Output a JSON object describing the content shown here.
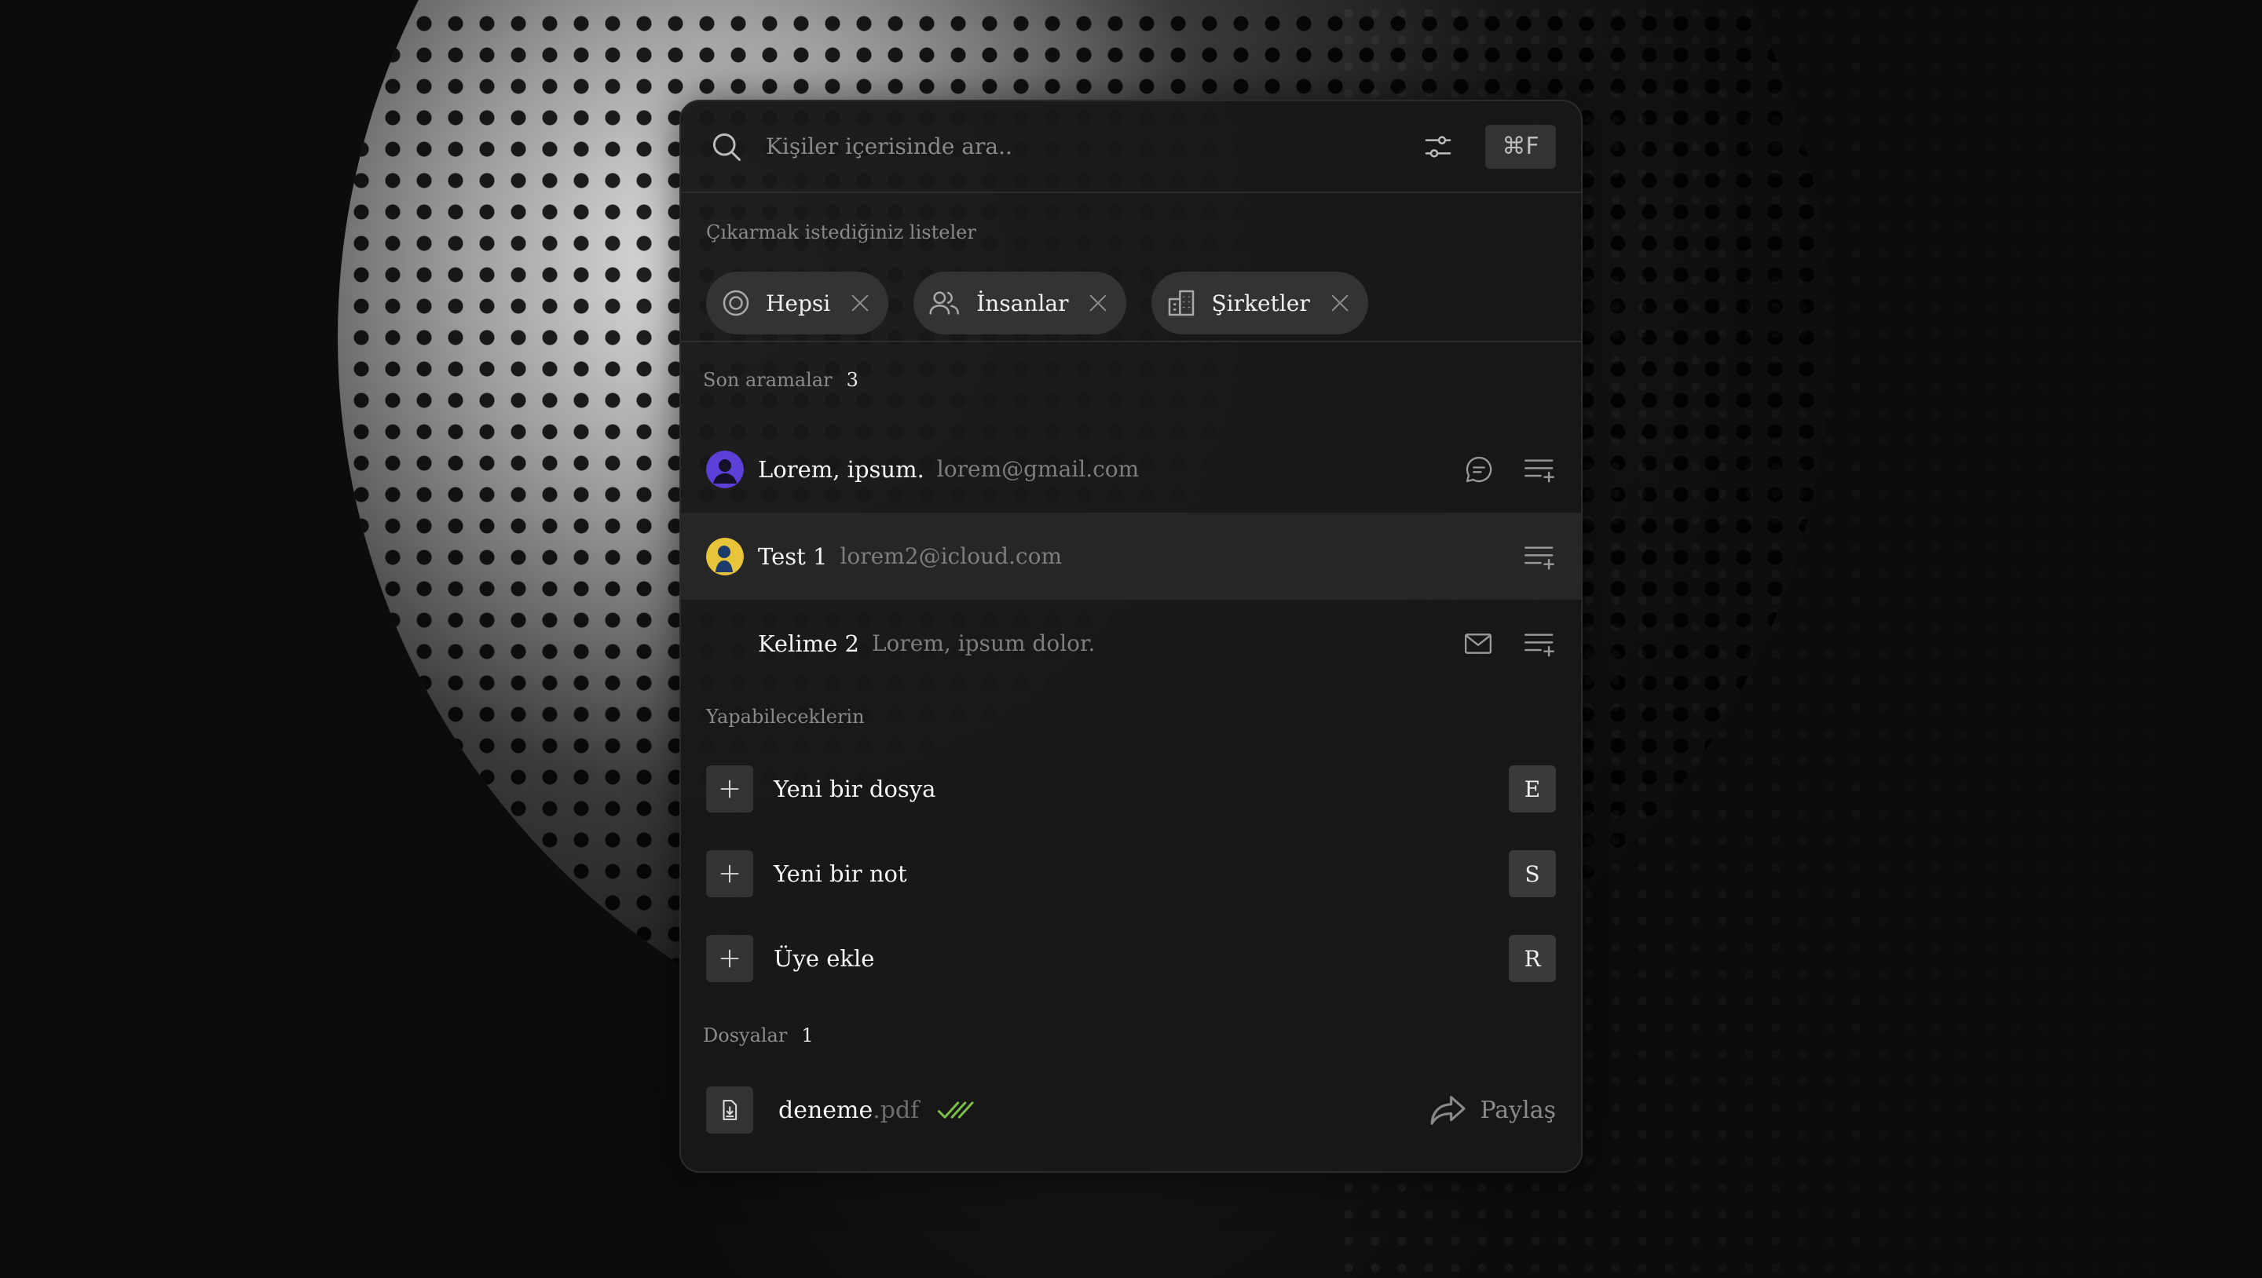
{
  "search": {
    "placeholder": "Kişiler içerisinde ara..",
    "shortcut": "⌘F"
  },
  "lists": {
    "label": "Çıkarmak istediğiniz listeler",
    "chips": [
      {
        "label": "Hepsi",
        "icon": "target-icon"
      },
      {
        "label": "İnsanlar",
        "icon": "users-icon"
      },
      {
        "label": "Şirketler",
        "icon": "building-icon"
      }
    ]
  },
  "recent": {
    "label": "Son aramalar",
    "count": "3",
    "items": [
      {
        "name": "Lorem, ipsum.",
        "sub": "lorem@gmail.com",
        "avatar_color": "#5b3fd6",
        "actions": [
          "chat-icon",
          "add-to-list-icon"
        ]
      },
      {
        "name": "Test 1",
        "sub": "lorem2@icloud.com",
        "avatar_color": "#e8c43a",
        "actions": [
          "add-to-list-icon"
        ]
      },
      {
        "name": "Kelime 2",
        "sub": "Lorem, ipsum dolor.",
        "avatar_color": "",
        "actions": [
          "mail-icon",
          "add-to-list-icon"
        ]
      }
    ]
  },
  "actions": {
    "label": "Yapabileceklerin",
    "items": [
      {
        "label": "Yeni bir dosya",
        "key": "E"
      },
      {
        "label": "Yeni bir not",
        "key": "S"
      },
      {
        "label": "Üye ekle",
        "key": "R"
      }
    ]
  },
  "files": {
    "label": "Dosyalar",
    "count": "1",
    "items": [
      {
        "name": "deneme",
        "ext": ".pdf",
        "share_label": "Paylaş",
        "check_color": "#7bc043"
      }
    ]
  }
}
